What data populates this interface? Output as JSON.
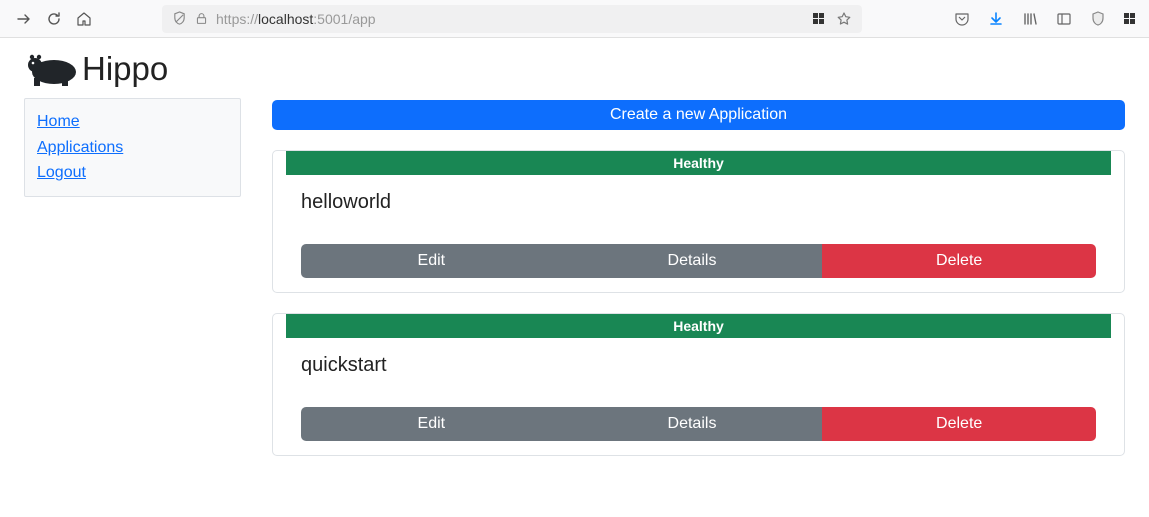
{
  "browser": {
    "url_prefix": "https://",
    "url_host": "localhost",
    "url_port": ":5001",
    "url_path": "/app"
  },
  "brand": {
    "name": "Hippo"
  },
  "sidebar": {
    "items": [
      {
        "label": "Home"
      },
      {
        "label": "Applications"
      },
      {
        "label": "Logout"
      }
    ]
  },
  "main": {
    "create_label": "Create a new Application",
    "apps": [
      {
        "status": "Healthy",
        "name": "helloworld",
        "buttons": {
          "edit": "Edit",
          "details": "Details",
          "delete": "Delete"
        }
      },
      {
        "status": "Healthy",
        "name": "quickstart",
        "buttons": {
          "edit": "Edit",
          "details": "Details",
          "delete": "Delete"
        }
      }
    ]
  }
}
